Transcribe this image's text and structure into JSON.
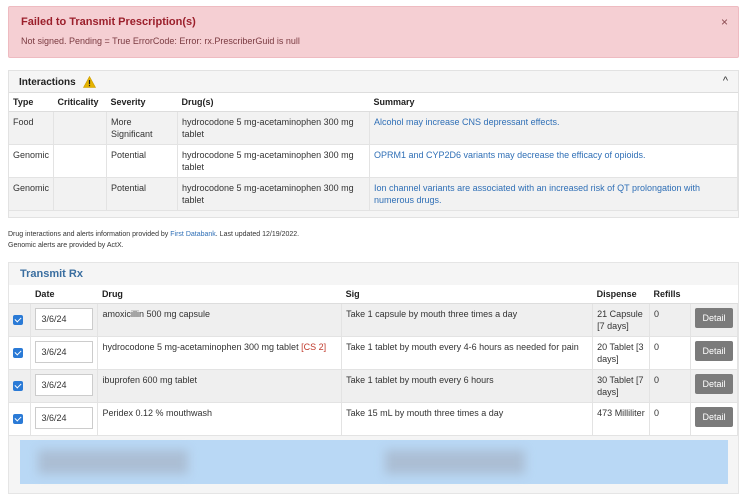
{
  "alert": {
    "title": "Failed to Transmit Prescription(s)",
    "message": "Not signed. Pending = True ErrorCode: Error: rx.PrescriberGuid is null",
    "close": "×"
  },
  "interactions": {
    "title": "Interactions",
    "collapse": "^",
    "headers": [
      "Type",
      "Criticality",
      "Severity",
      "Drug(s)",
      "Summary"
    ],
    "rows": [
      {
        "type": "Food",
        "criticality": "",
        "severity": "More Significant",
        "drugs": "hydrocodone 5 mg-acetaminophen 300 mg tablet",
        "summary": "Alcohol may increase CNS depressant effects."
      },
      {
        "type": "Genomic",
        "criticality": "",
        "severity": "Potential",
        "drugs": "hydrocodone 5 mg-acetaminophen 300 mg tablet",
        "summary": "OPRM1 and CYP2D6 variants may decrease the efficacy of opioids."
      },
      {
        "type": "Genomic",
        "criticality": "",
        "severity": "Potential",
        "drugs": "hydrocodone 5 mg-acetaminophen 300 mg tablet",
        "summary": "Ion channel variants are associated with an increased risk of QT prolongation with numerous drugs."
      }
    ]
  },
  "credits": {
    "line1_pre": "Drug interactions and alerts information provided by ",
    "line1_link": "First Databank",
    "line1_post": ". Last updated 12/19/2022.",
    "line2": "Genomic alerts are provided by ActX."
  },
  "transmit": {
    "title": "Transmit Rx",
    "headers": [
      "",
      "Date",
      "Drug",
      "Sig",
      "Dispense",
      "Refills",
      ""
    ],
    "rows": [
      {
        "checked": true,
        "date": "3/6/24",
        "drug": "amoxicillin 500 mg capsule",
        "cs": "",
        "sig": "Take 1 capsule by mouth three times a day",
        "dispense": "21 Capsule [7 days]",
        "refills": "0",
        "action": "Detail"
      },
      {
        "checked": true,
        "date": "3/6/24",
        "drug": "hydrocodone 5 mg-acetaminophen 300 mg tablet",
        "cs": "[CS 2]",
        "sig": "Take 1 tablet by mouth every 4-6 hours as needed for pain",
        "dispense": "20 Tablet [3 days]",
        "refills": "0",
        "action": "Detail"
      },
      {
        "checked": true,
        "date": "3/6/24",
        "drug": "ibuprofen 600 mg tablet",
        "cs": "",
        "sig": "Take 1 tablet by mouth every 6 hours",
        "dispense": "30 Tablet [7 days]",
        "refills": "0",
        "action": "Detail"
      },
      {
        "checked": true,
        "date": "3/6/24",
        "drug": "Peridex 0.12 % mouthwash",
        "cs": "",
        "sig": "Take 15 mL by mouth three times a day",
        "dispense": "473 Milliliter",
        "refills": "0",
        "action": "Detail"
      }
    ]
  },
  "colors": {
    "alert_bg": "#f5cfd3",
    "alert_text": "#9b1f2b",
    "link": "#2f6fb6",
    "accent_blue": "#2a7ad6",
    "detail_button": "#7b7b7b",
    "footer_bar": "#b9d8f5"
  }
}
